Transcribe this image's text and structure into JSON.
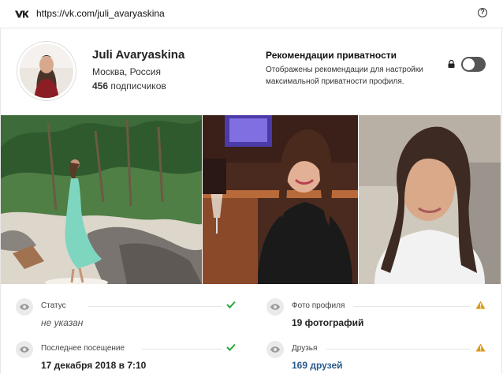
{
  "browser": {
    "url": "https://vk.com/juli_avaryaskina",
    "logo_icon": "vk-logo-icon",
    "help_icon": "question-circle-icon",
    "help_symbol": "?"
  },
  "profile": {
    "name": "Juli Avaryaskina",
    "location": "Москва, Россия",
    "subscribers_count": "456",
    "subscribers_label": "подписчиков"
  },
  "privacy": {
    "title": "Рекомендации приватности",
    "description": "Отображены рекомендации для настройки максимальной приватности профиля.",
    "toggle_on": false
  },
  "stats": [
    {
      "label": "Статус",
      "value": "не указан",
      "style": "italic",
      "status": "ok"
    },
    {
      "label": "Фото профиля",
      "value": "19 фотографий",
      "style": "bold",
      "status": "warning"
    },
    {
      "label": "Последнее посещение",
      "value": "17 декабря 2018 в 7:10",
      "style": "bold",
      "status": "ok"
    },
    {
      "label": "Друзья",
      "value": "169 друзей",
      "style": "link",
      "status": "warning"
    }
  ],
  "colors": {
    "ok": "#2aa63c",
    "warning": "#d99a1a",
    "link": "#2a5a8c",
    "toggle_off": "#555555"
  }
}
